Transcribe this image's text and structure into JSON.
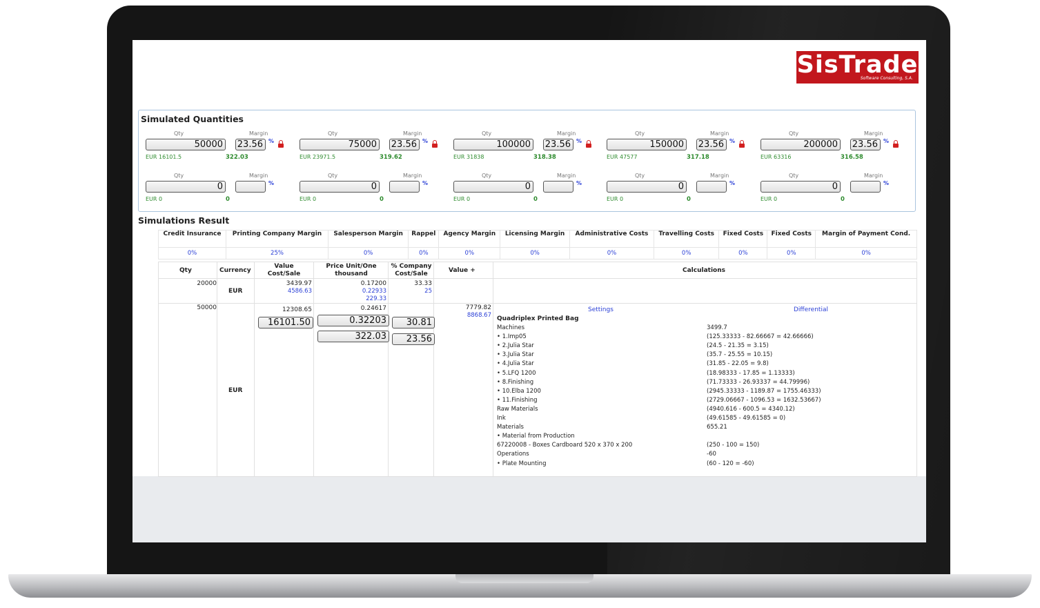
{
  "logo": {
    "name": "SisTrade",
    "tagline": "Software Consulting, S.A."
  },
  "simulated": {
    "title": "Simulated Quantities",
    "qty_label": "Qty",
    "margin_label": "Margin",
    "percent_symbol": "%",
    "row1": [
      {
        "qty": "50000",
        "margin": "23.56",
        "eur": "EUR 16101.5",
        "mval": "322.03"
      },
      {
        "qty": "75000",
        "margin": "23.56",
        "eur": "EUR 23971.5",
        "mval": "319.62"
      },
      {
        "qty": "100000",
        "margin": "23.56",
        "eur": "EUR 31838",
        "mval": "318.38"
      },
      {
        "qty": "150000",
        "margin": "23.56",
        "eur": "EUR 47577",
        "mval": "317.18"
      },
      {
        "qty": "200000",
        "margin": "23.56",
        "eur": "EUR 63316",
        "mval": "316.58"
      }
    ],
    "row2": [
      {
        "qty": "0",
        "margin": "",
        "eur": "EUR 0",
        "mval": "0"
      },
      {
        "qty": "0",
        "margin": "",
        "eur": "EUR 0",
        "mval": "0"
      },
      {
        "qty": "0",
        "margin": "",
        "eur": "EUR 0",
        "mval": "0"
      },
      {
        "qty": "0",
        "margin": "",
        "eur": "EUR 0",
        "mval": "0"
      },
      {
        "qty": "0",
        "margin": "",
        "eur": "EUR 0",
        "mval": "0"
      }
    ]
  },
  "results": {
    "title": "Simulations Result",
    "params_headers": [
      "Credit Insurance",
      "Printing Company Margin",
      "Salesperson Margin",
      "Rappel",
      "Agency Margin",
      "Licensing Margin",
      "Administrative Costs",
      "Travelling Costs",
      "Fixed Costs",
      "Fixed Costs",
      "Margin of Payment Cond."
    ],
    "params_values": [
      "0%",
      "25%",
      "0%",
      "0%",
      "0%",
      "0%",
      "0%",
      "0%",
      "0%",
      "0%",
      "0%"
    ],
    "cols": {
      "qty": "Qty",
      "currency": "Currency",
      "value": "Value Cost/Sale",
      "price": "Price Unit/One thousand",
      "company": "% Company Cost/Sale",
      "valueplus": "Value +",
      "calculations": "Calculations"
    },
    "row1": {
      "qty": "20000",
      "currency": "EUR",
      "value_cost": "3439.97",
      "value_sale": "4586.63",
      "price1": "0.17200",
      "price2": "0.22933",
      "price3": "229.33",
      "company1": "33.33",
      "company2": "25"
    },
    "row2": {
      "qty": "50000",
      "currency": "EUR",
      "value_cost": "12308.65",
      "value_input": "16101.50",
      "price1": "0.24617",
      "price_input1": "0.32203",
      "price_input2": "322.03",
      "company_input1": "30.81",
      "company_input2": "23.56",
      "valueplus1": "7779.82",
      "valueplus2": "8868.67"
    },
    "settings_link": "Settings",
    "differential_link": "Differential",
    "product": "Quadriplex Printed Bag",
    "calc_lines": [
      {
        "label": "Machines",
        "value": "3499.7",
        "bullet": false
      },
      {
        "label": "1.Imp05",
        "value": "(125.33333 - 82.66667 = 42.66666)",
        "bullet": true
      },
      {
        "label": "2.Julia Star",
        "value": "(24.5 - 21.35 = 3.15)",
        "bullet": true
      },
      {
        "label": "3.Julia Star",
        "value": "(35.7 - 25.55 = 10.15)",
        "bullet": true
      },
      {
        "label": "4.Julia Star",
        "value": "(31.85 - 22.05 = 9.8)",
        "bullet": true
      },
      {
        "label": "5.LFQ 1200",
        "value": "(18.98333 - 17.85 = 1.13333)",
        "bullet": true
      },
      {
        "label": "8.Finishing",
        "value": "(71.73333 - 26.93337 = 44.79996)",
        "bullet": true
      },
      {
        "label": "10.Elba 1200",
        "value": "(2945.33333 - 1189.87 = 1755.46333)",
        "bullet": true
      },
      {
        "label": "11.Finishing",
        "value": "(2729.06667 - 1096.53 = 1632.53667)",
        "bullet": true
      },
      {
        "label": "Raw Materials",
        "value": "(4940.616 - 600.5 = 4340.12)",
        "bullet": false
      },
      {
        "label": "Ink",
        "value": "(49.61585 - 49.61585 = 0)",
        "bullet": false
      },
      {
        "label": "Materials",
        "value": "655.21",
        "bullet": false
      },
      {
        "label": "Material from Production",
        "value": "",
        "bullet": true
      },
      {
        "label": "67220008 - Boxes Cardboard 520 x 370 x 200",
        "value": "(250 - 100 = 150)",
        "bullet": false
      },
      {
        "label": "Operations",
        "value": "-60",
        "bullet": false
      },
      {
        "label": "Plate Mounting",
        "value": "(60 - 120 = -60)",
        "bullet": true
      }
    ]
  }
}
